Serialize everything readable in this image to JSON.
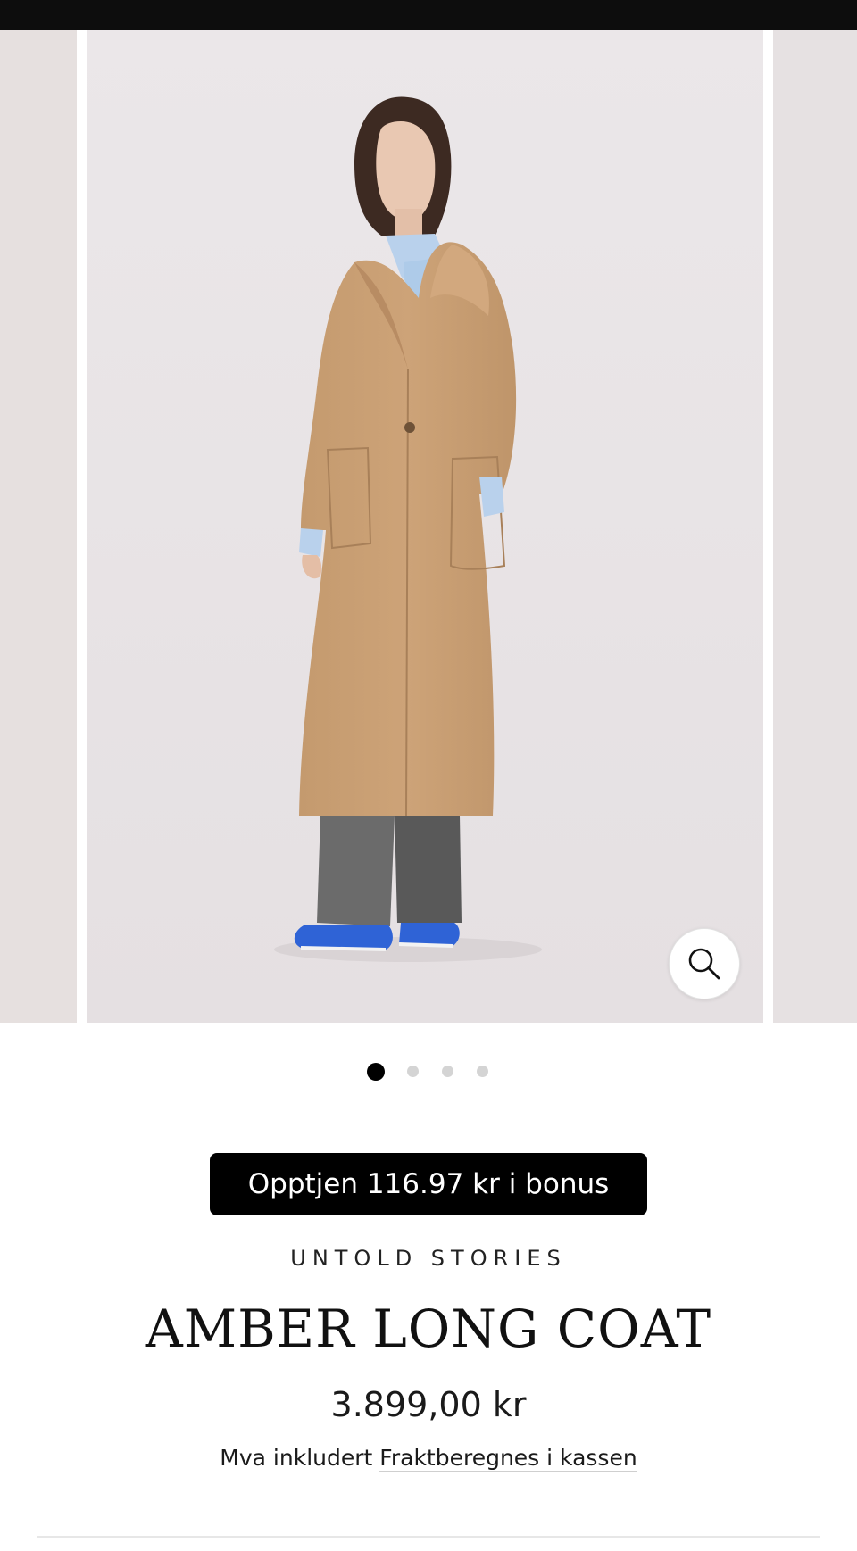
{
  "gallery": {
    "slide_count": 4,
    "active_index": 0
  },
  "product": {
    "bonus_label": "Opptjen 116.97 kr i bonus",
    "vendor": "UNTOLD STORIES",
    "title": "AMBER LONG COAT",
    "price": "3.899,00 kr",
    "tax_note": "Mva inkludert",
    "shipping_link": "Fraktberegnes i kassen"
  },
  "icons": {
    "zoom": "search-icon"
  },
  "colors": {
    "status_bar": "#0d0d0d",
    "image_background": "#e8e4e6",
    "coat": "#c99f73",
    "shirt": "#b9d1ec",
    "trousers": "#6b6b6b",
    "shoes": "#2f63d6",
    "bonus_button": "#000000",
    "dot_active": "#000000",
    "dot_inactive": "#d4d4d4"
  }
}
